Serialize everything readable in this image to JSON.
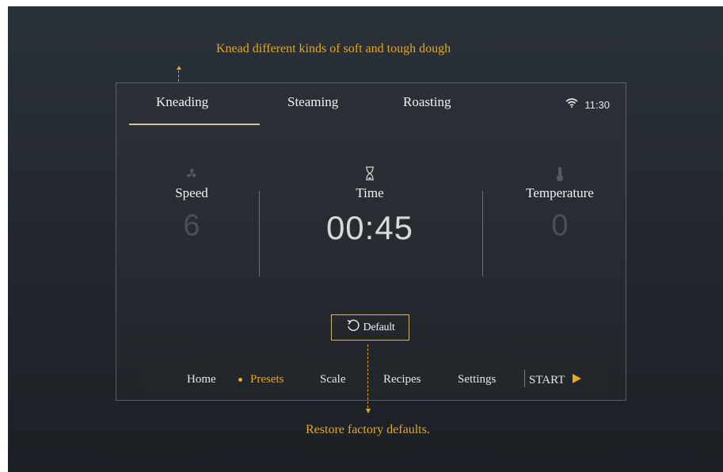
{
  "annotations": {
    "top": "Knead different kinds of soft and tough dough",
    "bottom": "Restore factory defaults."
  },
  "tabs": [
    {
      "label": "Kneading",
      "active": true
    },
    {
      "label": "Steaming",
      "active": false
    },
    {
      "label": "Roasting",
      "active": false
    }
  ],
  "status": {
    "time": "11:30",
    "wifi_icon": "wifi-icon"
  },
  "readouts": {
    "speed": {
      "icon": "fan-icon",
      "label": "Speed",
      "value": "6"
    },
    "time": {
      "icon": "hourglass-icon",
      "label": "Time",
      "value": "00:45"
    },
    "temperature": {
      "icon": "thermometer-icon",
      "label": "Temperature",
      "value": "0"
    }
  },
  "default_button": {
    "icon": "reset-icon",
    "label": "Default"
  },
  "nav": {
    "items": [
      {
        "label": "Home",
        "active": false
      },
      {
        "label": "Presets",
        "active": true
      },
      {
        "label": "Scale",
        "active": false
      },
      {
        "label": "Recipes",
        "active": false
      },
      {
        "label": "Settings",
        "active": false
      }
    ],
    "start_label": "START",
    "start_icon": "play-icon"
  },
  "colors": {
    "accent": "#e7a71f",
    "background": "#262b31",
    "text": "#f2f2f2",
    "muted_value": "#4a4f55"
  }
}
